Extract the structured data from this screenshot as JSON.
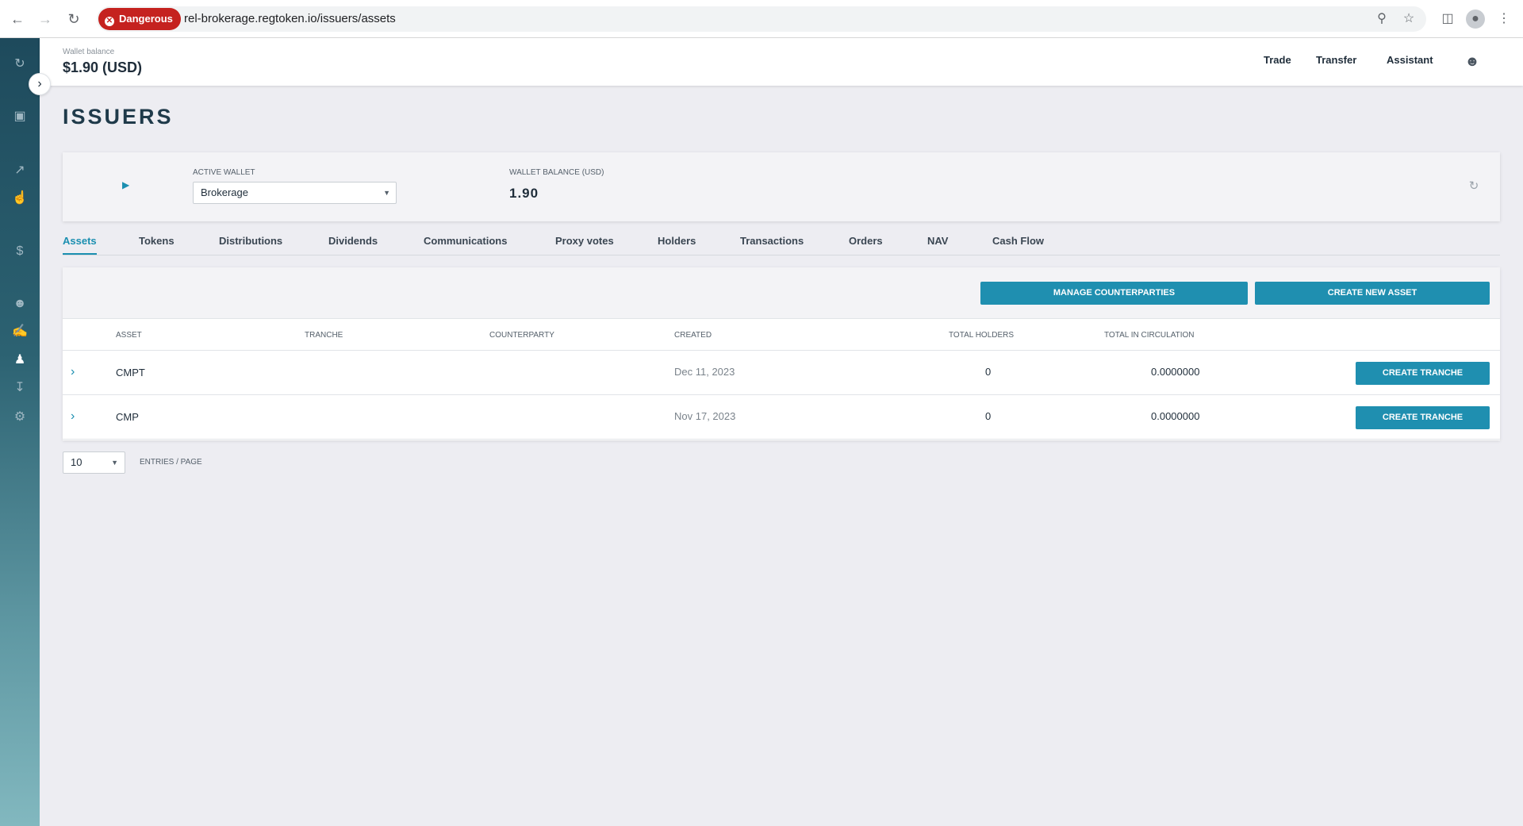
{
  "browser": {
    "security_label": "Dangerous",
    "url": "rel-brokerage.regtoken.io/issuers/assets"
  },
  "header": {
    "wallet_caption": "Wallet balance",
    "wallet_value": "$1.90 (USD)",
    "links": [
      "Trade",
      "Transfer",
      "Assistant"
    ]
  },
  "page_title": "ISSUERS",
  "wallet_card": {
    "active_wallet_label": "ACTIVE WALLET",
    "active_wallet_value": "Brokerage",
    "balance_label": "WALLET BALANCE (USD)",
    "balance_value": "1.90"
  },
  "tabs": [
    "Assets",
    "Tokens",
    "Distributions",
    "Dividends",
    "Communications",
    "Proxy votes",
    "Holders",
    "Transactions",
    "Orders",
    "NAV",
    "Cash Flow"
  ],
  "toolbar": {
    "manage_counterparties": "MANAGE COUNTERPARTIES",
    "create_new_asset": "CREATE NEW ASSET"
  },
  "table": {
    "columns": [
      "ASSET",
      "TRANCHE",
      "COUNTERPARTY",
      "CREATED",
      "TOTAL HOLDERS",
      "TOTAL IN CIRCULATION"
    ],
    "rows": [
      {
        "asset": "CMPT",
        "tranche": "",
        "counterparty": "",
        "created": "Dec 11, 2023",
        "holders": "0",
        "circulation": "0.0000000",
        "action": "CREATE TRANCHE"
      },
      {
        "asset": "CMP",
        "tranche": "",
        "counterparty": "",
        "created": "Nov 17, 2023",
        "holders": "0",
        "circulation": "0.0000000",
        "action": "CREATE TRANCHE"
      }
    ]
  },
  "pagination": {
    "page_size": "10",
    "entries_label": "ENTRIES / PAGE"
  },
  "colors": {
    "accent": "#1f8fb0",
    "danger": "#c5221f",
    "sidebar_top": "#1e4a5c",
    "sidebar_bottom": "#82b8bf"
  },
  "icons": {
    "sidebar": [
      "sync-icon",
      "wallet-icon",
      "trending-up-icon",
      "hand-coin-icon",
      "dollar-coin-icon",
      "people-icon",
      "handshake-icon",
      "person-transfer-icon",
      "inbox-download-icon",
      "settings-arrows-icon"
    ]
  }
}
